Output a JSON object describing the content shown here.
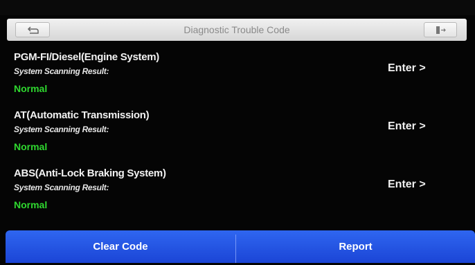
{
  "header": {
    "title": "Diagnostic Trouble Code",
    "back_icon": "back-arrow-icon",
    "exit_icon": "exit-door-icon"
  },
  "systems": [
    {
      "name": "PGM-FI/Diesel(Engine System)",
      "scan_label": "System Scanning Result:",
      "result": "Normal",
      "enter_label": "Enter >"
    },
    {
      "name": "AT(Automatic Transmission)",
      "scan_label": "System Scanning Result:",
      "result": "Normal",
      "enter_label": "Enter >"
    },
    {
      "name": "ABS(Anti-Lock Braking System)",
      "scan_label": "System Scanning Result:",
      "result": "Normal",
      "enter_label": "Enter >"
    }
  ],
  "footer": {
    "clear_label": "Clear Code",
    "report_label": "Report"
  },
  "colors": {
    "background": "#050505",
    "result_normal": "#2fd82f",
    "footer_blue": "#1b45d6",
    "title_gray": "#8a8a8a"
  }
}
